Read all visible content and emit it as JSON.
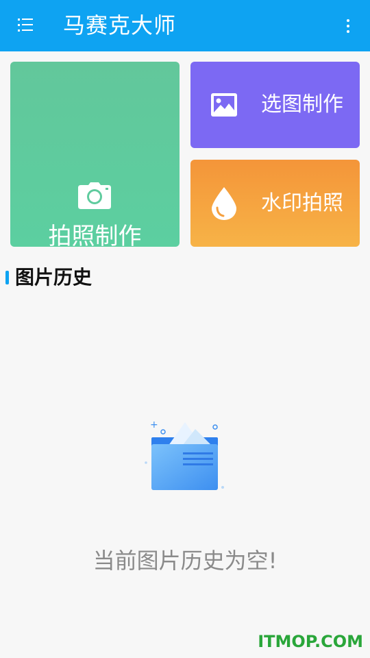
{
  "app_bar": {
    "title": "马赛克大师",
    "menu_icon": "list-menu-icon",
    "more_icon": "more-vertical-icon",
    "color": "#0ea3f2"
  },
  "actions": {
    "photo": {
      "label": "拍照制作",
      "icon": "camera-icon",
      "color": "#5fcb9e"
    },
    "pick": {
      "label": "选图制作",
      "icon": "image-icon",
      "color": "#7c69f3"
    },
    "watermark": {
      "label": "水印拍照",
      "icon": "water-drop-icon",
      "color": "#f5a03f"
    }
  },
  "history": {
    "title": "图片历史",
    "empty_icon": "empty-folder-icon",
    "empty_text": "当前图片历史为空!"
  },
  "watermark_text": "ITMOP.COM"
}
